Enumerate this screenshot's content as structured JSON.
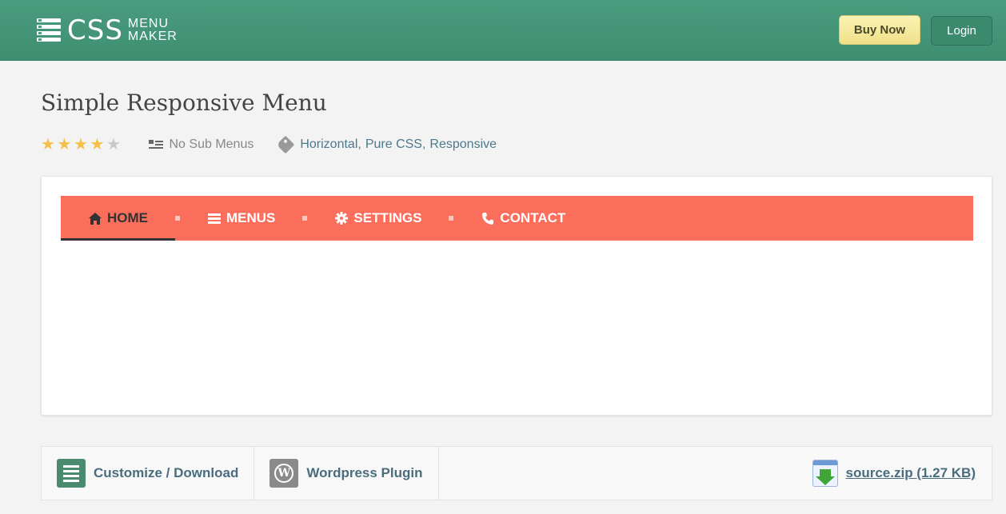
{
  "header": {
    "logo": {
      "main": "CSS",
      "sub_line1": "MENU",
      "sub_line2": "MAKER"
    },
    "buy_label": "Buy Now",
    "login_label": "Login"
  },
  "page": {
    "title": "Simple Responsive Menu",
    "rating": {
      "value": 4,
      "max": 5
    },
    "submenu_label": "No Sub Menus",
    "tags": [
      "Horizontal",
      "Pure CSS",
      "Responsive"
    ]
  },
  "demo_menu": {
    "items": [
      {
        "label": "HOME",
        "icon": "home-icon",
        "active": true
      },
      {
        "label": "MENUS",
        "icon": "bars-icon",
        "active": false
      },
      {
        "label": "SETTINGS",
        "icon": "gear-icon",
        "active": false
      },
      {
        "label": "CONTACT",
        "icon": "phone-icon",
        "active": false
      }
    ],
    "accent_color": "#fb6e5c"
  },
  "footer_bar": {
    "customize_label": "Customize / Download",
    "wordpress_label": "Wordpress Plugin",
    "download_label": "source.zip (1.27 KB)"
  },
  "colors": {
    "header_bg": "#4a9c7f",
    "buy_button": "#f5e89a",
    "link": "#4c7a8c"
  }
}
